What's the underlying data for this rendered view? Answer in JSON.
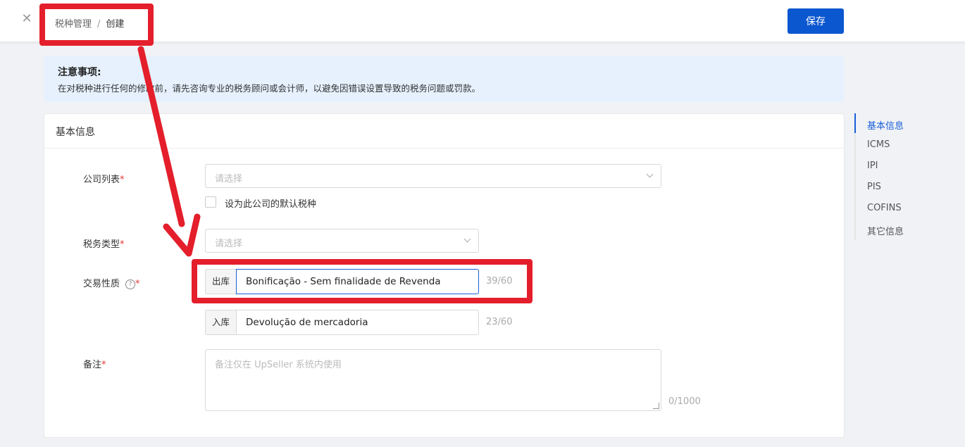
{
  "header": {
    "breadcrumb": [
      "税种管理",
      "/",
      "创建"
    ],
    "save_label": "保存"
  },
  "notice": {
    "title": "注意事项:",
    "body": "在对税种进行任何的修改前，请先咨询专业的税务顾问或会计师，以避免因错误设置导致的税务问题或罚款。"
  },
  "section": {
    "title": "基本信息"
  },
  "form": {
    "company": {
      "label": "公司列表",
      "required": "*",
      "placeholder": "请选择"
    },
    "default_checkbox": {
      "label": "设为此公司的默认税种"
    },
    "tax_type": {
      "label": "税务类型",
      "required": "*",
      "placeholder": "请选择"
    },
    "transaction": {
      "label": "交易性质",
      "help": "?",
      "required": "*",
      "outbound": {
        "addon": "出库",
        "value": "Bonificação - Sem finalidade de Revenda",
        "counter": "39/60"
      },
      "inbound": {
        "addon": "入库",
        "value": "Devolução de mercadoria",
        "counter": "23/60"
      }
    },
    "remark": {
      "label": "备注",
      "required": "*",
      "placeholder": "备注仅在 UpSeller 系统内使用",
      "counter": "0/1000"
    }
  },
  "anchor_nav": {
    "items": [
      "基本信息",
      "ICMS",
      "IPI",
      "PIS",
      "COFINS",
      "其它信息"
    ],
    "active": "基本信息"
  },
  "annotation": {
    "color": "#e41e2b"
  }
}
